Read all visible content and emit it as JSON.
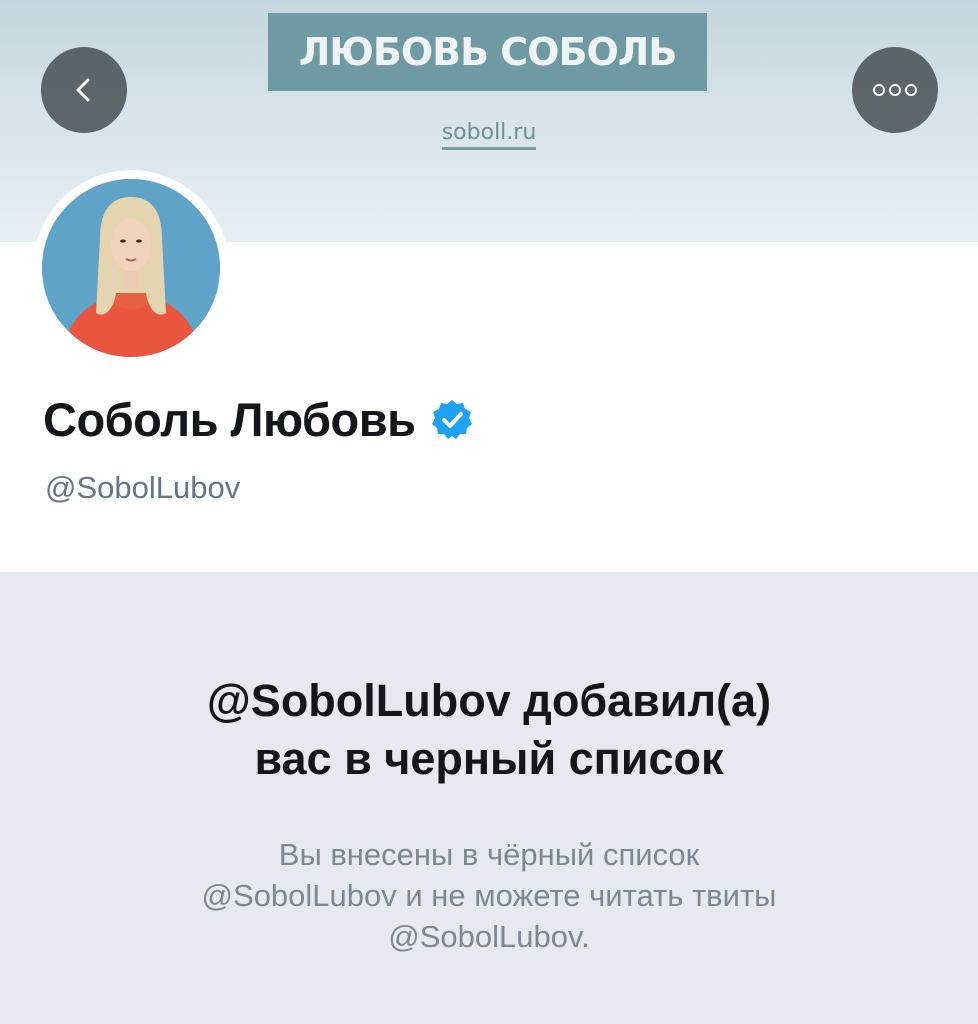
{
  "banner": {
    "title": "ЛЮБОВЬ СОБОЛЬ",
    "url": "soboll.ru"
  },
  "nav": {
    "back_icon": "chevron-left-icon",
    "more_icon": "more-horizontal-icon"
  },
  "profile": {
    "name": "Соболь Любовь",
    "handle": "@SobolLubov",
    "verified_icon": "verified-badge-icon",
    "verified_color": "#1da1f2"
  },
  "blocked": {
    "title_line1": "@SobolLubov добавил(а)",
    "title_line2": "вас в черный список",
    "desc_line1": "Вы внесены в чёрный список",
    "desc_line2": "@SobolLubov и не можете читать твиты",
    "desc_line3": "@SobolLubov."
  },
  "colors": {
    "banner_label_bg": "#6f9aa3",
    "blocked_bg": "#e6e9f0",
    "secondary_text": "#657786"
  }
}
